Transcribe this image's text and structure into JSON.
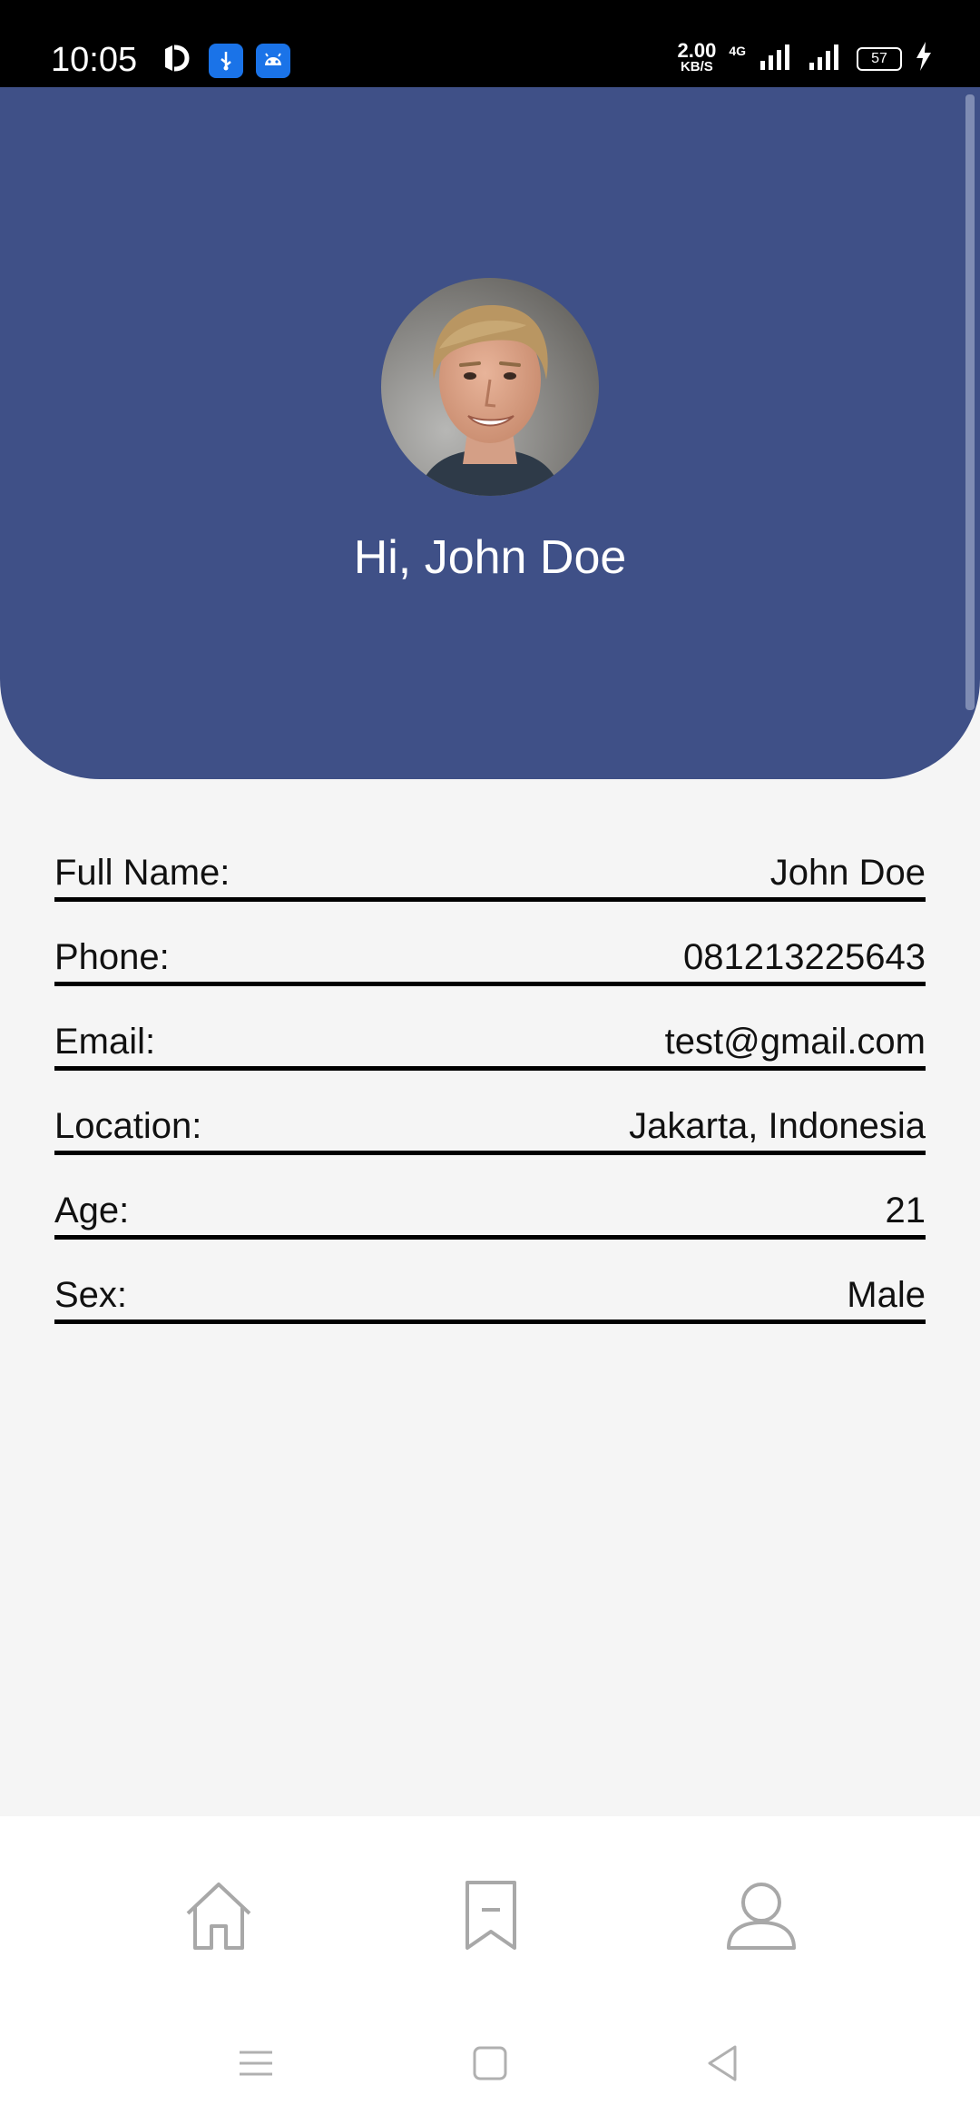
{
  "status_bar": {
    "time": "10:05",
    "speed_value": "2.00",
    "speed_unit": "KB/S",
    "network": "4G",
    "battery": "57",
    "icons": [
      "notification-icon",
      "usb-debugging-icon",
      "android-icon",
      "signal-icon",
      "signal-icon",
      "charging-icon"
    ]
  },
  "profile": {
    "greeting": "Hi, John Doe"
  },
  "details": [
    {
      "label": "Full Name:",
      "value": "John Doe"
    },
    {
      "label": "Phone:",
      "value": "081213225643"
    },
    {
      "label": "Email:",
      "value": "test@gmail.com"
    },
    {
      "label": "Location:",
      "value": "Jakarta, Indonesia"
    },
    {
      "label": "Age:",
      "value": "21"
    },
    {
      "label": "Sex:",
      "value": "Male"
    }
  ],
  "bottom_nav": {
    "items": [
      "home-icon",
      "bookmark-icon",
      "profile-icon"
    ]
  },
  "system_nav": {
    "buttons": [
      "menu-icon",
      "home-square-icon",
      "back-icon"
    ]
  },
  "colors": {
    "header": "#3f5087",
    "background": "#f5f5f5"
  }
}
